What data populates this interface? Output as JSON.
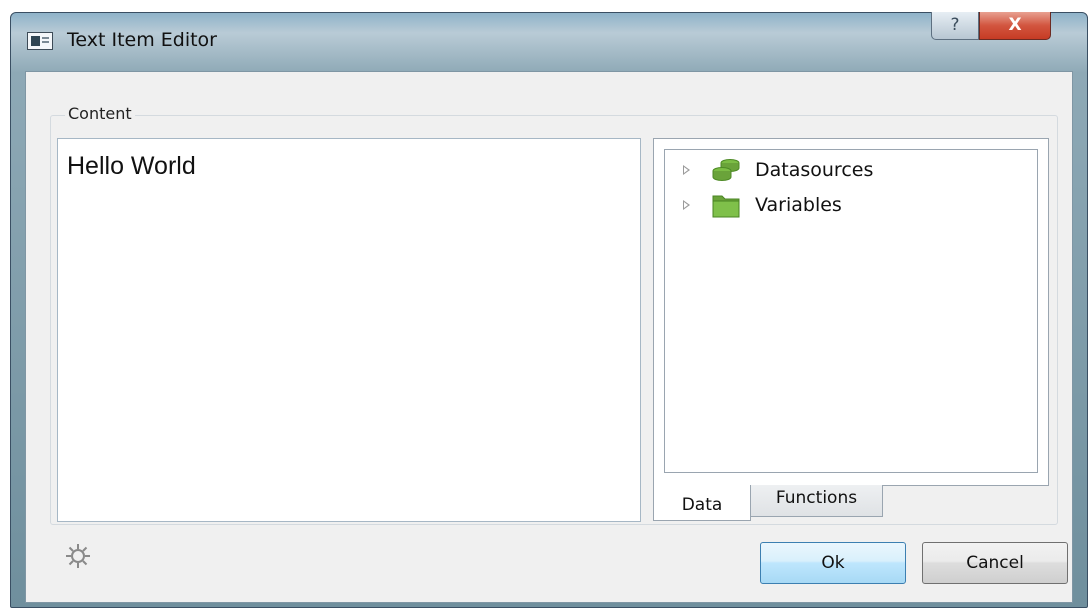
{
  "window": {
    "title": "Text Item Editor",
    "help_label": "?",
    "close_label": "X"
  },
  "content": {
    "group_title": "Content",
    "editor_text": "Hello World"
  },
  "tree": {
    "items": [
      {
        "label": "Datasources",
        "icon": "database-icon"
      },
      {
        "label": "Variables",
        "icon": "folder-icon"
      }
    ]
  },
  "tabs": [
    {
      "label": "Data",
      "active": true
    },
    {
      "label": "Functions",
      "active": false
    }
  ],
  "buttons": {
    "ok": "Ok",
    "cancel": "Cancel"
  },
  "colors": {
    "ok_border": "#3c7fb1",
    "close_red": "#c63b24",
    "tree_icon_green": "#6aa33a"
  }
}
